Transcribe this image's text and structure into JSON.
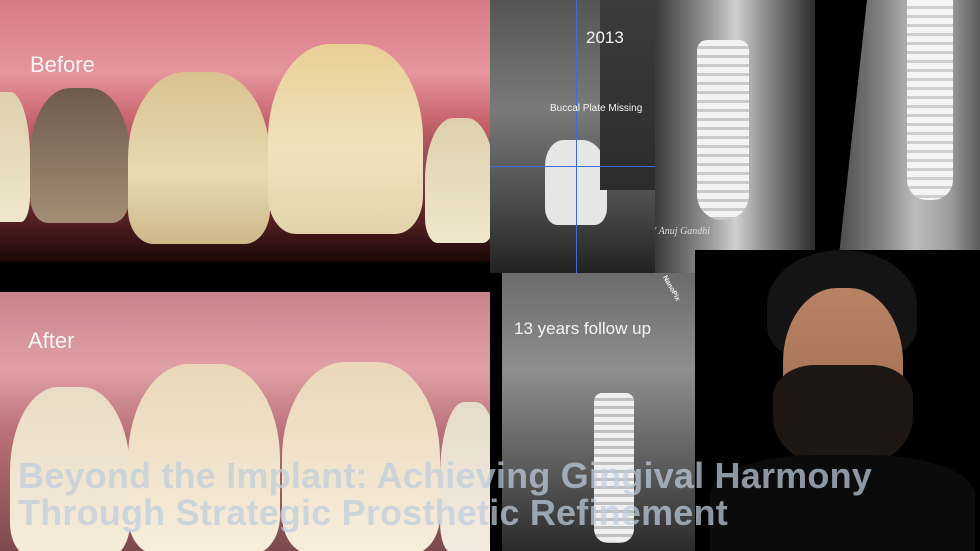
{
  "labels": {
    "before": "Before",
    "after": "After",
    "year": "2013",
    "annotation": "Buccal Plate Missing",
    "followup": "13 years follow up",
    "watermark": "D' Anuj Gandhi",
    "nanopix": "NanoPix"
  },
  "title": {
    "line1": "Beyond the Implant: Achieving Gingival Harmony",
    "line2": "Through Strategic Prosthetic Refinement"
  }
}
